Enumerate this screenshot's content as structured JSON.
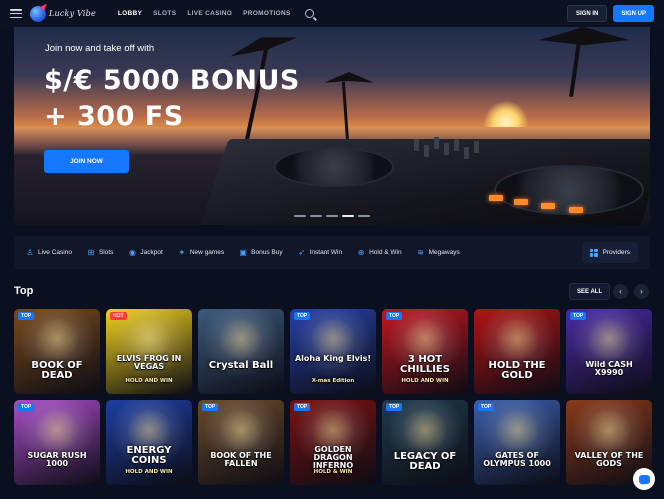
{
  "header": {
    "logo_text": "Lucky Vibe",
    "nav": [
      "LOBBY",
      "SLOTS",
      "LIVE CASINO",
      "PROMOTIONS"
    ],
    "signin": "SIGN IN",
    "signup": "SIGN UP"
  },
  "hero": {
    "subtitle": "Join now and take off with",
    "title_line1": "$/€ 5000 BONUS",
    "title_line2": "+ 300 FS",
    "cta": "JOIN NOW",
    "slides": 5,
    "active_slide": 4
  },
  "categories": {
    "items": [
      {
        "label": "Live Casino",
        "icon": "live-casino-icon"
      },
      {
        "label": "Slots",
        "icon": "slots-icon"
      },
      {
        "label": "Jackpot",
        "icon": "jackpot-icon"
      },
      {
        "label": "New games",
        "icon": "new-games-icon"
      },
      {
        "label": "Bonus Buy",
        "icon": "bonus-buy-icon"
      },
      {
        "label": "Instant Win",
        "icon": "instant-win-icon"
      },
      {
        "label": "Hold & Win",
        "icon": "hold-win-icon"
      },
      {
        "label": "Megaways",
        "icon": "megaways-icon"
      }
    ],
    "providers": "Providers"
  },
  "top": {
    "title": "Top",
    "see_all": "SEE ALL",
    "games": [
      {
        "badge": "TOP",
        "name": "BOOK OF DEAD",
        "bg": "#7a4a1c"
      },
      {
        "badge": "HOT",
        "name": "ELVIS FROG IN VEGAS",
        "sub": "HOLD AND WIN",
        "bg": "#f0d21a"
      },
      {
        "badge": "",
        "name": "Crystal Ball",
        "bg": "#3c5a7e"
      },
      {
        "badge": "TOP",
        "name": "Aloha King Elvis!",
        "sub": "X-mas Edition",
        "bg": "#2740a8"
      },
      {
        "badge": "TOP",
        "name": "3 HOT CHILLIES",
        "sub": "HOLD AND WIN",
        "bg": "#c4161f"
      },
      {
        "badge": "",
        "name": "HOLD THE GOLD",
        "bg": "#b01414"
      },
      {
        "badge": "TOP",
        "name": "Wild CASH X9990",
        "bg": "#4a2ba6"
      },
      {
        "badge": "TOP",
        "name": "SUGAR RUSH 1000",
        "bg": "#a94cc9"
      },
      {
        "badge": "",
        "name": "ENERGY COINS",
        "sub": "HOLD AND WIN",
        "bg": "#1d3fa3"
      },
      {
        "badge": "TOP",
        "name": "BOOK OF THE FALLEN",
        "bg": "#6b4a2a"
      },
      {
        "badge": "TOP",
        "name": "GOLDEN DRAGON INFERNO",
        "sub": "HOLD & WIN",
        "bg": "#7c1212"
      },
      {
        "badge": "TOP",
        "name": "LEGACY OF DEAD",
        "bg": "#1e3b4d"
      },
      {
        "badge": "TOP",
        "name": "GATES OF OLYMPUS 1000",
        "bg": "#3a5fae"
      },
      {
        "badge": "",
        "name": "VALLEY OF THE GODS",
        "bg": "#8a3a1a"
      }
    ]
  },
  "colors": {
    "accent": "#1677ff",
    "background": "#0b1020"
  }
}
